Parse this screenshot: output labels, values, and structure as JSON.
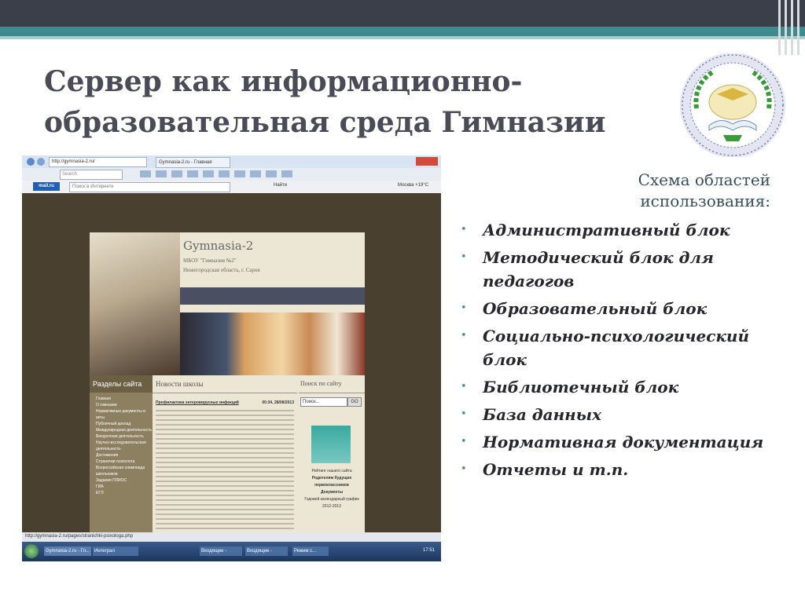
{
  "slide": {
    "title_line1": "Сервер как информационно-",
    "title_line2": "образовательная среда Гимназии",
    "accent_color": "#3f8a8c",
    "title_color": "#4b4b57"
  },
  "logo": {
    "icon": "gymnasium-emblem-icon"
  },
  "scheme": {
    "heading_line1": "Схема областей",
    "heading_line2": "использования:",
    "items": [
      "Административный блок",
      "Методический блок для педагогов",
      "Образовательный блок",
      "Социально-психологический блок",
      "Библиотечный блок",
      "База данных",
      "Нормативная документация",
      "Отчеты и т.п."
    ]
  },
  "browser": {
    "address": "http://gymnasia-2.ru/",
    "tab_title": "Gymnasia-2.ru - Главная",
    "search_placeholder": "Search",
    "mail_label": "mail.ru",
    "internet_search": "Поиск в Интернете",
    "find_label": "Найти",
    "weather": "Москва +19°C",
    "status_url": "http://gymnasia-2.ru/pages/stranichki-psixologa.php",
    "site": {
      "name": "Gymnasia-2",
      "org": "МБОУ \"Гимназия №2\"",
      "city": "Нижегородская область, г. Саров",
      "sections_title": "Разделы сайта",
      "sections": [
        "Главная",
        "О гимназии",
        "Нормативные документы и акты",
        "Публичный доклад",
        "Международная деятельность",
        "Внеурочная деятельность",
        "Научно-исследовательская деятельность",
        "Достижения",
        "Странички психолога",
        "Всероссийская олимпиада школьников",
        "Задания ПЛИОС",
        "ГИА",
        "ЕГЭ"
      ],
      "news_title": "Новости школы",
      "news_headline": "Профилактика энтеровирусных инфекций",
      "news_date": "00:34, 28/08/2013",
      "search_title": "Поиск по сайту",
      "search_field": "Поиск...",
      "search_go": "GO",
      "right_links": [
        "Рейтинг нашего сайта",
        "Родителям будущих первоклассников",
        "Документы",
        "Годовой календарный график 2012-2013"
      ]
    },
    "taskbar_items": [
      "Gymnasia-2.ru - Гл...",
      "Интеграл",
      "Входящие - olefirov...",
      "Входящие - olefirov...",
      "Режим с..."
    ],
    "clock": "17:51"
  }
}
